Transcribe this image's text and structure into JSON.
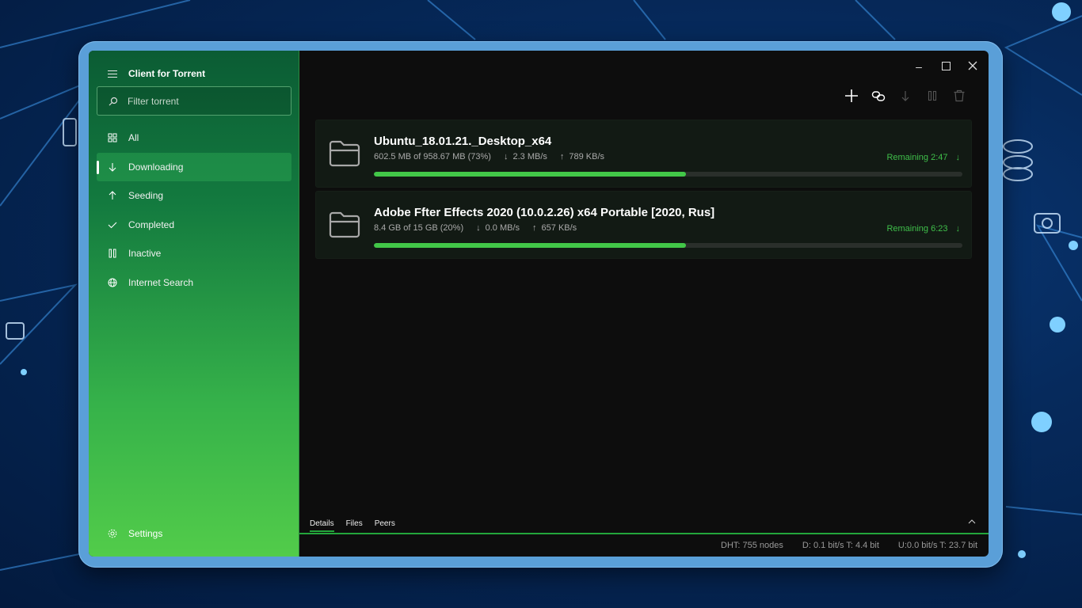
{
  "app": {
    "title": "Client for Torrent"
  },
  "search": {
    "placeholder": "Filter torrent"
  },
  "nav": [
    {
      "label": "All",
      "icon": "grid-icon"
    },
    {
      "label": "Downloading",
      "icon": "arrow-down-icon",
      "active": true
    },
    {
      "label": "Seeding",
      "icon": "arrow-up-icon"
    },
    {
      "label": "Completed",
      "icon": "check-icon"
    },
    {
      "label": "Inactive",
      "icon": "pause-icon"
    },
    {
      "label": "Internet Search",
      "icon": "globe-icon"
    }
  ],
  "settings": {
    "label": "Settings",
    "icon": "gear-icon"
  },
  "toolbar": [
    "add-icon",
    "link-icon",
    "download-icon",
    "pause-icon",
    "delete-icon"
  ],
  "torrents": [
    {
      "name": "Ubuntu_18.01.21._Desktop_x64",
      "size": "602.5 MB of 958.67 MB  (73%)",
      "down": "2.3 MB/s",
      "up": "789 KB/s",
      "remaining": "Remaining 2:47",
      "progress": 0.53
    },
    {
      "name": "Adobe Ffter Effects 2020 (10.0.2.26) x64 Portable  [2020, Rus]",
      "size": "8.4 GB of 15 GB  (20%)",
      "down": "0.0 MB/s",
      "up": "657 KB/s",
      "remaining": "Remaining 6:23",
      "progress": 0.53
    }
  ],
  "details_tabs": [
    "Details",
    "Files",
    "Peers"
  ],
  "status": {
    "dht": "DHT: 755 nodes",
    "down": "D: 0.1 bit/s T: 4.4 bit",
    "up": "U:0.0 bit/s T: 23.7 bit"
  },
  "colors": {
    "accent": "#42c748",
    "sidebar_top": "#0b5c34",
    "sidebar_bottom": "#52cc4a"
  }
}
